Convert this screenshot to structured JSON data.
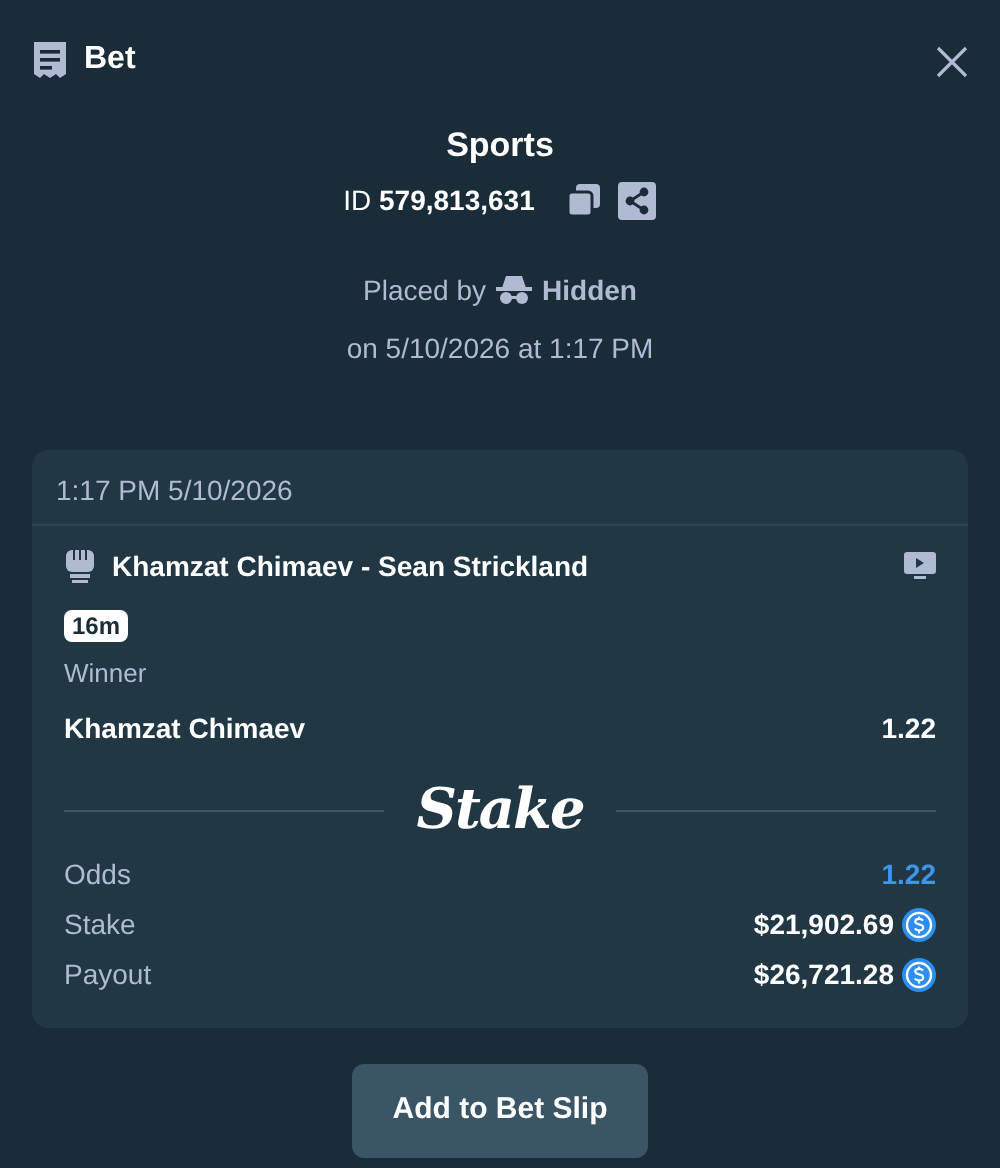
{
  "header": {
    "title": "Bet"
  },
  "bet": {
    "category": "Sports",
    "id_label": "ID",
    "id_value": "579,813,631",
    "placed_by_label": "Placed by",
    "placed_by_user": "Hidden",
    "placed_on": "on 5/10/2026 at 1:17 PM"
  },
  "slip": {
    "timestamp": "1:17 PM 5/10/2026",
    "event": "Khamzat Chimaev - Sean Strickland",
    "time_badge": "16m",
    "market": "Winner",
    "selection": "Khamzat Chimaev",
    "selection_odds": "1.22",
    "brand": "Stake",
    "summary": [
      {
        "label": "Odds",
        "value": "1.22",
        "kind": "odds"
      },
      {
        "label": "Stake",
        "value": "$21,902.69",
        "kind": "amount"
      },
      {
        "label": "Payout",
        "value": "$26,721.28",
        "kind": "amount"
      }
    ]
  },
  "button": "Add to Bet Slip"
}
